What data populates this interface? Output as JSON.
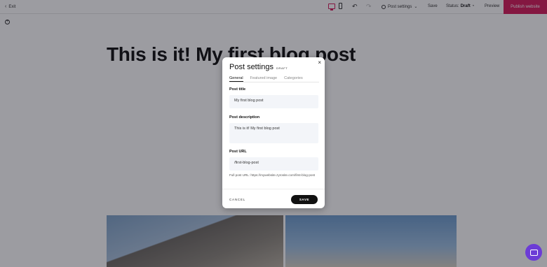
{
  "toolbar": {
    "exit_label": "Exit",
    "post_settings_label": "Post settings",
    "save_label": "Save",
    "status_label": "Status:",
    "status_value": "Draft",
    "preview_label": "Preview",
    "publish_label": "Publish website"
  },
  "page": {
    "blog_title": "This is it! My first blog post"
  },
  "modal": {
    "title": "Post settings",
    "badge": "DRAFT",
    "close_glyph": "×",
    "tabs": [
      {
        "label": "General",
        "active": true
      },
      {
        "label": "Featured image",
        "active": false
      },
      {
        "label": "Categories",
        "active": false
      }
    ],
    "post_title_label": "Post title",
    "post_title_value": "My first blog post",
    "post_description_label": "Post description",
    "post_description_value": "This is it! My first blog post",
    "post_url_label": "Post URL",
    "post_url_value": "/first-blog-post",
    "full_url_help": "Full post URL: https://mywebsite.zyrosite.com/first-blog-post",
    "cancel_label": "CANCEL",
    "save_label": "SAVE"
  },
  "colors": {
    "accent": "#d61a5b",
    "chat": "#6c3cd6"
  }
}
